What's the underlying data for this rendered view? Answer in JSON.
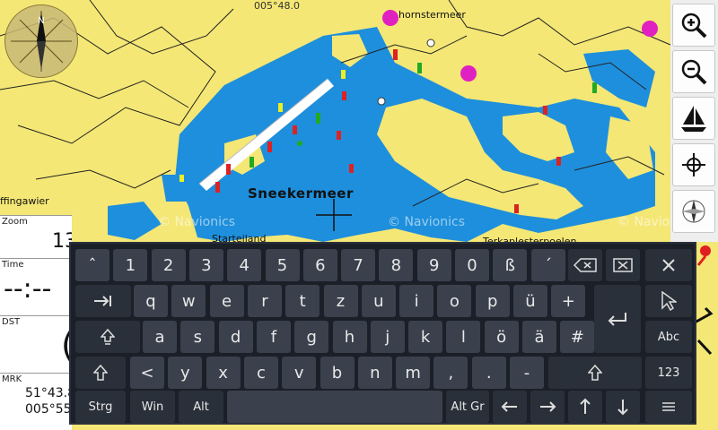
{
  "map": {
    "lake_label": "Sneekermeer",
    "coord_top": "005°48.0",
    "place_left": "ffingawier",
    "place_north": "hornstermeer",
    "place_start": "Starteiland",
    "place_se": "Terkaplesterpoelen",
    "watermark": "© Navionics"
  },
  "toolbar": {
    "icons": [
      "zoom-in-icon",
      "zoom-out-icon",
      "sailboat-icon",
      "crosshair-icon",
      "compass-rose-icon",
      "route-icon"
    ]
  },
  "info_panel": {
    "zoom_title": "Zoom",
    "zoom_value": "13",
    "time_title": "Time",
    "time_value": "--:--",
    "dst_title": "DST",
    "dst_value": "(",
    "mrk_title": "MRK",
    "mrk_lat": "51°43.8",
    "mrk_lon": "005°55"
  },
  "keyboard": {
    "row1": [
      "ˆ",
      "1",
      "2",
      "3",
      "4",
      "5",
      "6",
      "7",
      "8",
      "9",
      "0",
      "ß",
      "´"
    ],
    "row2": [
      "q",
      "w",
      "e",
      "r",
      "t",
      "z",
      "u",
      "i",
      "o",
      "p",
      "ü",
      "+"
    ],
    "row3": [
      "a",
      "s",
      "d",
      "f",
      "g",
      "h",
      "j",
      "k",
      "l",
      "ö",
      "ä",
      "#"
    ],
    "row4": [
      "<",
      "y",
      "x",
      "c",
      "v",
      "b",
      "n",
      "m",
      ",",
      ".",
      "-"
    ],
    "row5": {
      "ctrl": "Strg",
      "win": "Win",
      "alt": "Alt",
      "altgr": "Alt Gr"
    },
    "side": {
      "abc": "Abc",
      "num": "123"
    }
  }
}
